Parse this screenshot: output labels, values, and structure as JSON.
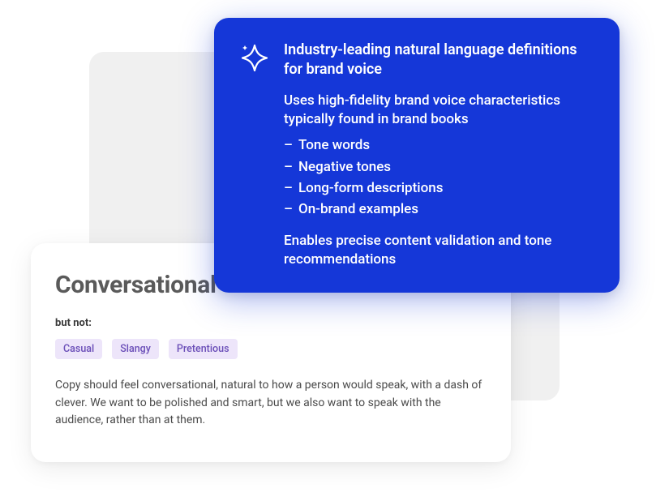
{
  "white_card": {
    "title": "Conversational",
    "but_not_label": "but not:",
    "tags": [
      "Casual",
      "Slangy",
      "Pretentious"
    ],
    "description": "Copy should feel conversational, natural to how a person would speak, with a dash of clever. We want to be polished and smart, but we also want to speak with the audience, rather than at them."
  },
  "blue_card": {
    "heading": "Industry-leading natural language definitions for brand voice",
    "sub": "Uses high-fidelity brand voice characteristics typically found in brand books",
    "bullets": [
      "Tone words",
      "Negative tones",
      "Long-form descriptions",
      "On-brand examples"
    ],
    "footer": "Enables precise content validation and tone recommendations"
  }
}
